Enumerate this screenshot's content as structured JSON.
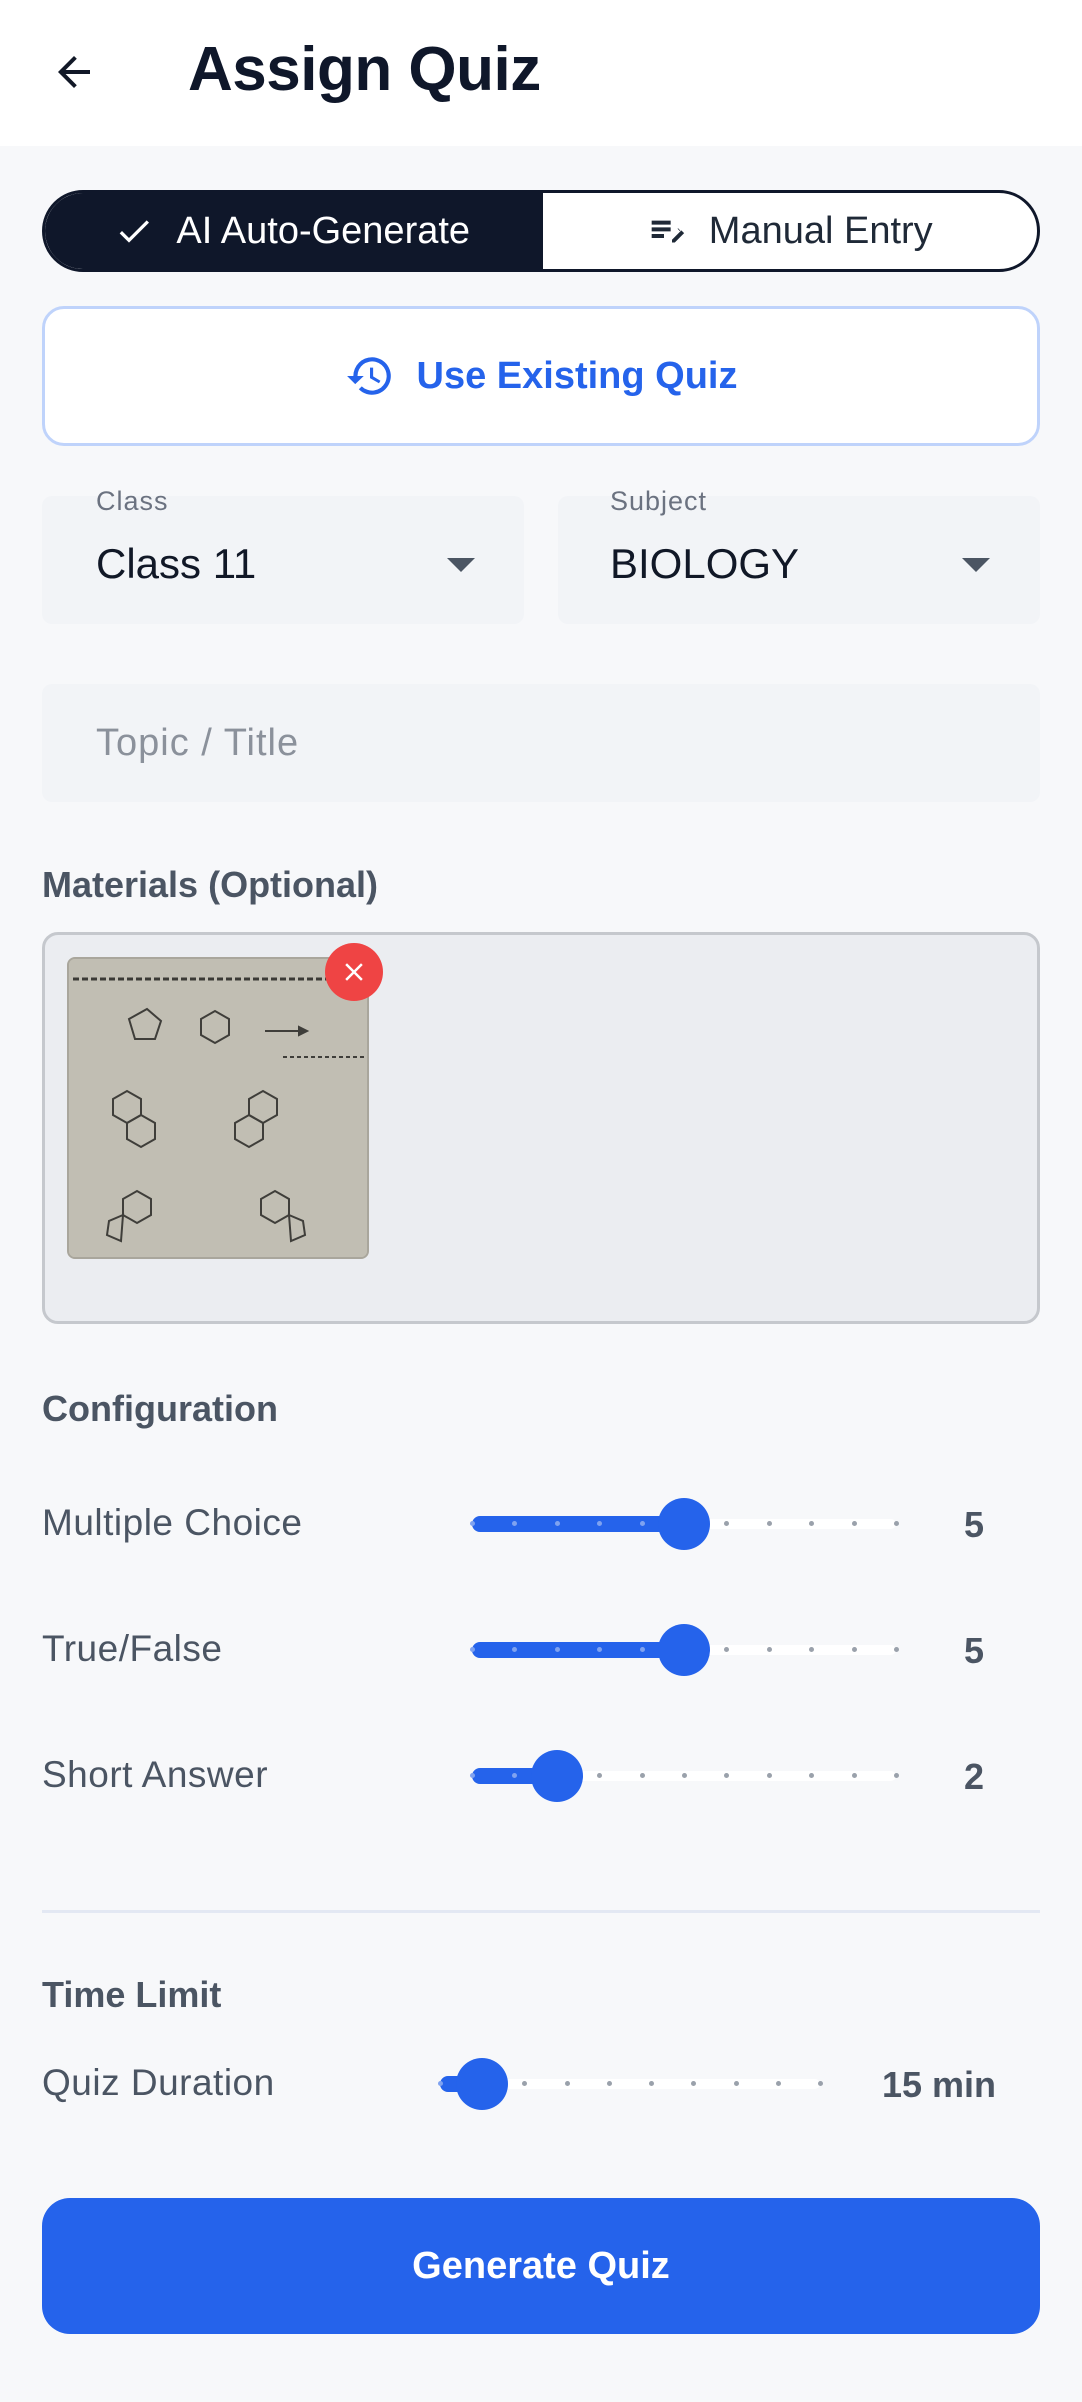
{
  "header": {
    "title": "Assign Quiz"
  },
  "mode_toggle": {
    "auto_label": "AI Auto-Generate",
    "manual_label": "Manual Entry"
  },
  "existing_quiz": {
    "label": "Use Existing Quiz"
  },
  "class_select": {
    "label": "Class",
    "value": "Class 11"
  },
  "subject_select": {
    "label": "Subject",
    "value": "BIOLOGY"
  },
  "topic": {
    "placeholder": "Topic / Title",
    "value": ""
  },
  "materials": {
    "title": "Materials (Optional)",
    "attachments": [
      {
        "kind": "photo",
        "remove_icon": "close-icon"
      }
    ]
  },
  "configuration": {
    "title": "Configuration",
    "items": [
      {
        "label": "Multiple Choice",
        "value": "5",
        "level": 5,
        "max": 10
      },
      {
        "label": "True/False",
        "value": "5",
        "level": 5,
        "max": 10
      },
      {
        "label": "Short Answer",
        "value": "2",
        "level": 2,
        "max": 10
      }
    ]
  },
  "time_limit": {
    "title": "Time Limit",
    "label": "Quiz Duration",
    "value": "15 min",
    "level": 1,
    "steps": 9
  },
  "actions": {
    "generate_label": "Generate Quiz"
  },
  "colors": {
    "primary": "#2563eb",
    "dark": "#0f172a",
    "danger": "#ef4444"
  }
}
